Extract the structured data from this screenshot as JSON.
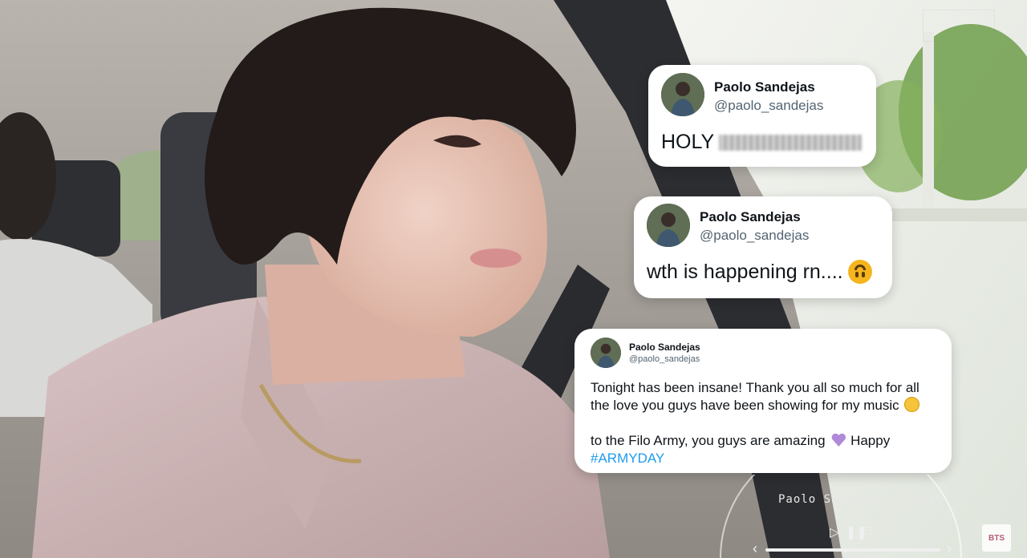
{
  "tweets": [
    {
      "display_name": "Paolo Sandejas",
      "handle": "@paolo_sandejas",
      "text": "HOLY",
      "text_censored": true
    },
    {
      "display_name": "Paolo Sandejas",
      "handle": "@paolo_sandejas",
      "text": "wth is happening rn....",
      "emoji": "upside-down-face"
    },
    {
      "display_name": "Paolo Sandejas",
      "handle": "@paolo_sandejas",
      "paragraph1": "Tonight has been insane! Thank you all so much for all the love you guys have been showing for my music",
      "paragraph1_emoji": "relieved-face",
      "paragraph2_text": "to the Filo Army, you guys are amazing",
      "paragraph2_emoji": "purple-heart",
      "paragraph2_suffix": "Happy",
      "hashtag": "#ARMYDAY"
    }
  ],
  "player": {
    "title": "Paolo Sandejas - Sorry",
    "play_icon": "play-icon",
    "pause_icon": "pause-icon",
    "stop_icon": "stop-icon"
  },
  "logo": {
    "text": "BTS"
  },
  "colors": {
    "hashtag": "#1d9bf0",
    "card_bg": "#ffffff",
    "name": "#0f1419",
    "handle": "#536471"
  }
}
